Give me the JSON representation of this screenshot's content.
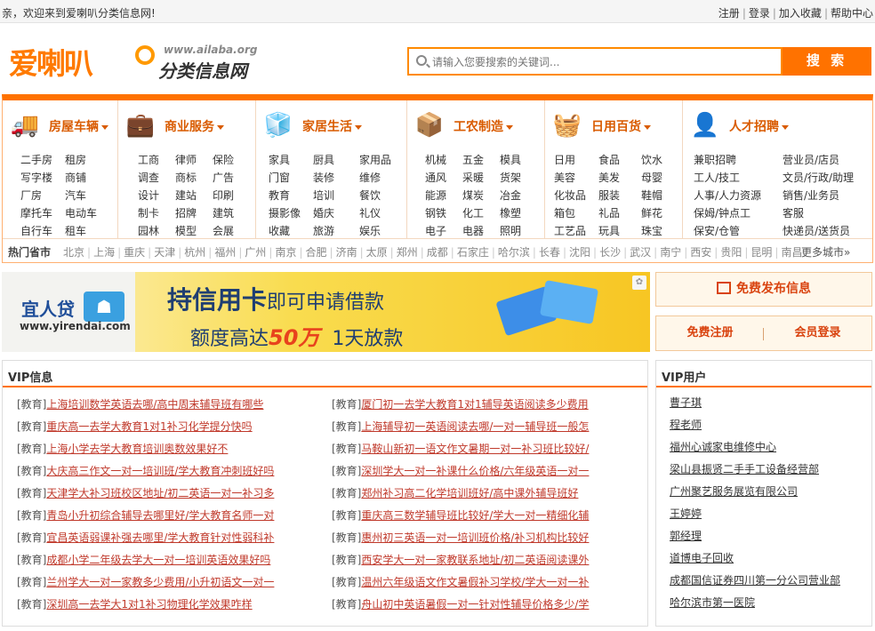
{
  "topbar": {
    "welcome": "亲，欢迎来到爱喇叭分类信息网!",
    "links": [
      "注册",
      "登录",
      "加入收藏",
      "帮助中心"
    ]
  },
  "logo": {
    "name": "爱喇叭",
    "url": "www.ailaba.org",
    "subtitle": "分类信息网"
  },
  "search": {
    "placeholder": "请输入您要搜索的关键词...",
    "button": "搜 索"
  },
  "categories": [
    {
      "title": "房屋车辆",
      "icon": "truck-icon",
      "items": [
        [
          "二手房",
          "租房"
        ],
        [
          "写字楼",
          "商铺"
        ],
        [
          "厂房",
          "汽车"
        ],
        [
          "摩托车",
          "电动车"
        ],
        [
          "自行车",
          "租车"
        ]
      ]
    },
    {
      "title": "商业服务",
      "icon": "briefcase-icon",
      "items": [
        [
          "工商",
          "律师",
          "保险"
        ],
        [
          "调查",
          "商标",
          "广告"
        ],
        [
          "设计",
          "建站",
          "印刷"
        ],
        [
          "制卡",
          "招牌",
          "建筑"
        ],
        [
          "园林",
          "模型",
          "会展"
        ]
      ]
    },
    {
      "title": "家居生活",
      "icon": "cube-icon",
      "items": [
        [
          "家具",
          "厨具",
          "家用品"
        ],
        [
          "门窗",
          "装修",
          "维修"
        ],
        [
          "教育",
          "培训",
          "餐饮"
        ],
        [
          "摄影像",
          "婚庆",
          "礼仪"
        ],
        [
          "收藏",
          "旅游",
          "娱乐"
        ]
      ]
    },
    {
      "title": "工农制造",
      "icon": "box-icon",
      "items": [
        [
          "机械",
          "五金",
          "模具"
        ],
        [
          "通风",
          "采暖",
          "货架"
        ],
        [
          "能源",
          "煤炭",
          "冶金"
        ],
        [
          "钢铁",
          "化工",
          "橡塑"
        ],
        [
          "电子",
          "电器",
          "照明"
        ]
      ]
    },
    {
      "title": "日用百货",
      "icon": "basket-icon",
      "items": [
        [
          "日用",
          "食品",
          "饮水"
        ],
        [
          "美容",
          "美发",
          "母婴"
        ],
        [
          "化妆品",
          "服装",
          "鞋帽"
        ],
        [
          "箱包",
          "礼品",
          "鲜花"
        ],
        [
          "工艺品",
          "玩具",
          "珠宝"
        ]
      ]
    },
    {
      "title": "人才招聘",
      "icon": "person-icon",
      "items": [
        [
          "兼职招聘",
          "营业员/店员"
        ],
        [
          "工人/技工",
          "文员/行政/助理"
        ],
        [
          "人事/人力资源",
          "销售/业务员"
        ],
        [
          "保姆/钟点工",
          "客服"
        ],
        [
          "保安/仓管",
          "快递员/送货员"
        ]
      ]
    }
  ],
  "hotcities": {
    "label": "热门省市",
    "cities": [
      "北京",
      "上海",
      "重庆",
      "天津",
      "杭州",
      "福州",
      "广州",
      "南京",
      "合肥",
      "济南",
      "太原",
      "郑州",
      "成都",
      "石家庄",
      "哈尔滨",
      "长春",
      "沈阳",
      "长沙",
      "武汉",
      "南宁",
      "西安",
      "贵阳",
      "昆明",
      "南昌"
    ],
    "more": "更多城市»"
  },
  "banner": {
    "brand_name": "宜人贷",
    "brand_url": "www.yirendai.com",
    "headline": "持信用卡",
    "headline_small": "即可申请借款",
    "line2_a": "额度高达",
    "line2_amount": "50万",
    "line2_days": "1天放款"
  },
  "actions": {
    "publish": "免费发布信息",
    "register": "免费注册",
    "login": "会员登录"
  },
  "vipinfo": {
    "title": "VIP信息",
    "left": [
      {
        "tag": "[教育]",
        "text": "上海培训数学英语去哪/高中周末辅导班有哪些"
      },
      {
        "tag": "[教育]",
        "text": "重庆高一去学大教育1对1补习化学提分快吗"
      },
      {
        "tag": "[教育]",
        "text": "上海小学去学大教育培训奥数效果好不"
      },
      {
        "tag": "[教育]",
        "text": "大庆高三作文一对一培训班/学大教育冲刺班好吗"
      },
      {
        "tag": "[教育]",
        "text": "天津学大补习班校区地址/初二英语一对一补习多"
      },
      {
        "tag": "[教育]",
        "text": "青岛小升初综合辅导去哪里好/学大教育名师一对"
      },
      {
        "tag": "[教育]",
        "text": "宜昌英语弱课补强去哪里/学大教育针对性弱科补"
      },
      {
        "tag": "[教育]",
        "text": "成都小学二年级去学大一对一培训英语效果好吗"
      },
      {
        "tag": "[教育]",
        "text": "兰州学大一对一家教多少费用/小升初语文一对一"
      },
      {
        "tag": "[教育]",
        "text": "深圳高一去学大1对1补习物理化学效果咋样"
      }
    ],
    "right": [
      {
        "tag": "[教育]",
        "text": "厦门初一去学大教育1对1辅导英语阅读多少费用"
      },
      {
        "tag": "[教育]",
        "text": "上海辅导初一英语阅读去哪/一对一辅导班一般怎"
      },
      {
        "tag": "[教育]",
        "text": "马鞍山新初一语文作文暑期一对一补习班比较好/"
      },
      {
        "tag": "[教育]",
        "text": "深圳学大一对一补课什么价格/六年级英语一对一"
      },
      {
        "tag": "[教育]",
        "text": "郑州补习高二化学培训班好/高中课外辅导班好"
      },
      {
        "tag": "[教育]",
        "text": "重庆高三数学辅导班比较好/学大一对一精细化辅"
      },
      {
        "tag": "[教育]",
        "text": "惠州初三英语一对一培训班价格/补习机构比较好"
      },
      {
        "tag": "[教育]",
        "text": "西安学大一对一家教联系地址/初二英语阅读课外"
      },
      {
        "tag": "[教育]",
        "text": "温州六年级语文作文暑假补习学校/学大一对一补"
      },
      {
        "tag": "[教育]",
        "text": "舟山初中英语暑假一对一针对性辅导价格多少/学"
      }
    ]
  },
  "vipusers": {
    "title": "VIP用户",
    "users": [
      "曹子琪",
      "程老师",
      "福州心诚家电维修中心",
      "梁山县振贤二手手工设备经营部",
      "广州聚艺服务展览有限公司",
      "王婷婷",
      "郭经理",
      "道博电子回收",
      "成都国信证券四川第一分公司营业部",
      "哈尔滨市第一医院"
    ]
  },
  "colors": {
    "accent": "#ff7200",
    "link": "#c0392b",
    "title": "#d95b00"
  }
}
